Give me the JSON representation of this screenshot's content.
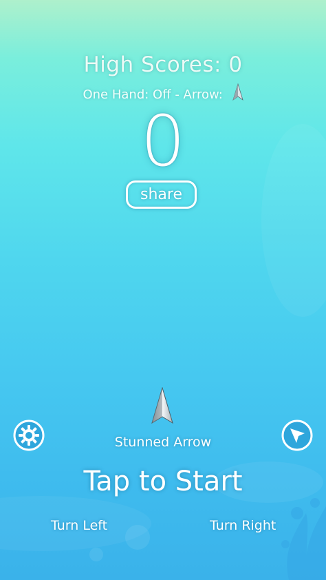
{
  "high_scores": {
    "label": "High Scores: 0"
  },
  "settings_line": {
    "text": "One Hand: Off - Arrow:"
  },
  "score": {
    "value": "0"
  },
  "share_button": {
    "label": "share"
  },
  "selected_arrow": {
    "name": "Stunned Arrow"
  },
  "tap_to_start": {
    "label": "Tap to Start"
  },
  "controls": {
    "turn_left": "Turn Left",
    "turn_right": "Turn Right"
  },
  "icons": {
    "settings": "gear-icon",
    "arrow_select": "navigation-arrow-icon",
    "player": "arrow-player-icon"
  },
  "colors": {
    "bg_top": "#aef0cc",
    "bg_mid": "#4fd6ee",
    "bg_bottom": "#3ab2ea",
    "text": "#ffffff"
  }
}
